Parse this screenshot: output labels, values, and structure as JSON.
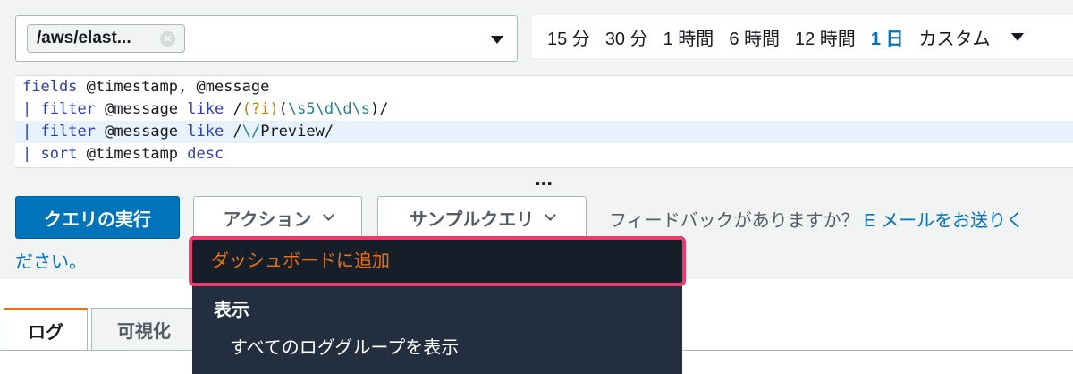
{
  "log_group": {
    "selected": "/aws/elast...",
    "clear_label": "×"
  },
  "time_range": {
    "options": [
      "15 分",
      "30 分",
      "1 時間",
      "6 時間",
      "12 時間",
      "1 日",
      "カスタム"
    ],
    "active": "1 日"
  },
  "query": {
    "lines": [
      "fields @timestamp, @message",
      "| filter @message like /(?i)(\\s5\\d\\d\\s)/",
      "| filter @message like /\\/Preview/",
      "| sort @timestamp desc"
    ]
  },
  "toolbar": {
    "run_label": "クエリの実行",
    "actions_label": "アクション",
    "sample_label": "サンプルクエリ",
    "feedback_text": "フィードバックがありますか？",
    "feedback_link": "E メールをお送りく",
    "feedback_link_wrap": "ださい。",
    "more": "…"
  },
  "actions_menu": {
    "highlighted": "ダッシュボードに追加",
    "group_label": "表示",
    "sub_item": "すべてのロググループを表示"
  },
  "tabs": [
    "ログ",
    "可視化"
  ],
  "colors": {
    "primary": "#0073bb",
    "accent": "#ec7211",
    "highlight_border": "#ec3b6b",
    "menu_bg": "#232f3e"
  }
}
